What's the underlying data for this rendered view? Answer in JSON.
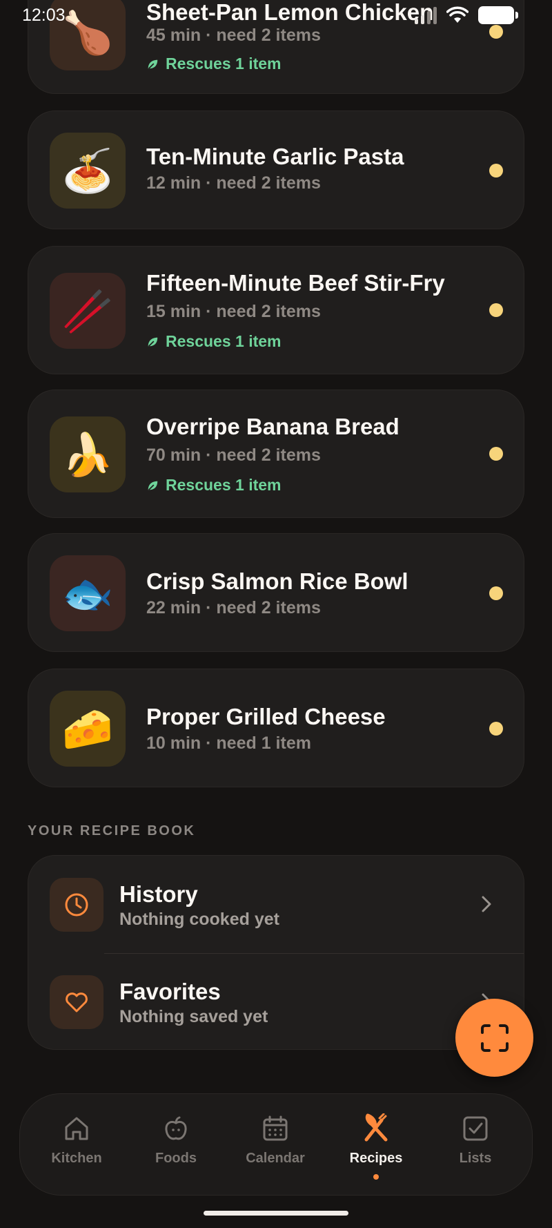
{
  "status_bar": {
    "time": "12:03"
  },
  "recipes": [
    {
      "title": "Sheet-Pan Lemon Chicken",
      "meta": "45 min · need 2 items",
      "rescue": "Rescues 1 item",
      "emoji": "🍗",
      "icon_name": "drumstick-icon"
    },
    {
      "title": "Ten-Minute Garlic Pasta",
      "meta": "12 min · need 2 items",
      "rescue": null,
      "emoji": "🍝",
      "icon_name": "spaghetti-icon"
    },
    {
      "title": "Fifteen-Minute Beef Stir-Fry",
      "meta": "15 min · need 2 items",
      "rescue": "Rescues 1 item",
      "emoji": "🥢",
      "icon_name": "chopsticks-icon"
    },
    {
      "title": "Overripe Banana Bread",
      "meta": "70 min · need 2 items",
      "rescue": "Rescues 1 item",
      "emoji": "🍌",
      "icon_name": "banana-icon"
    },
    {
      "title": "Crisp Salmon Rice Bowl",
      "meta": "22 min · need 2 items",
      "rescue": null,
      "emoji": "🐟",
      "icon_name": "fish-icon"
    },
    {
      "title": "Proper Grilled Cheese",
      "meta": "10 min · need 1 item",
      "rescue": null,
      "emoji": "🧀",
      "icon_name": "cheese-icon"
    }
  ],
  "recipe_book": {
    "section_label": "YOUR RECIPE BOOK",
    "history": {
      "title": "History",
      "subtitle": "Nothing cooked yet"
    },
    "favorites": {
      "title": "Favorites",
      "subtitle": "Nothing saved yet"
    }
  },
  "tabs": [
    {
      "label": "Kitchen",
      "icon": "house-icon",
      "active": false
    },
    {
      "label": "Foods",
      "icon": "apple-icon",
      "active": false
    },
    {
      "label": "Calendar",
      "icon": "calendar-icon",
      "active": false
    },
    {
      "label": "Recipes",
      "icon": "fork-knife-icon",
      "active": true
    },
    {
      "label": "Lists",
      "icon": "checkbox-icon",
      "active": false
    }
  ],
  "colors": {
    "accent": "#ff8a3d",
    "status_dot": "#f7d47b",
    "rescue_green": "#6fd39a",
    "background": "#151312",
    "card": "#201e1d"
  }
}
